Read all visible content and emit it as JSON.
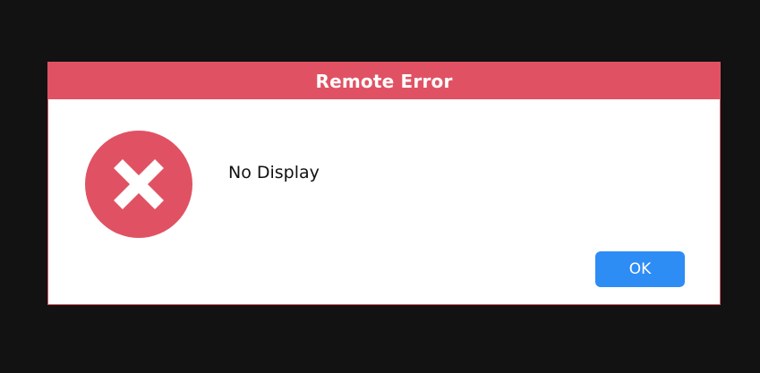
{
  "dialog": {
    "title": "Remote Error",
    "message": "No Display",
    "icon": "error-x-icon",
    "ok_label": "OK"
  },
  "colors": {
    "accent": "#e05263",
    "button": "#2e8cf5",
    "backdrop": "#121212"
  }
}
